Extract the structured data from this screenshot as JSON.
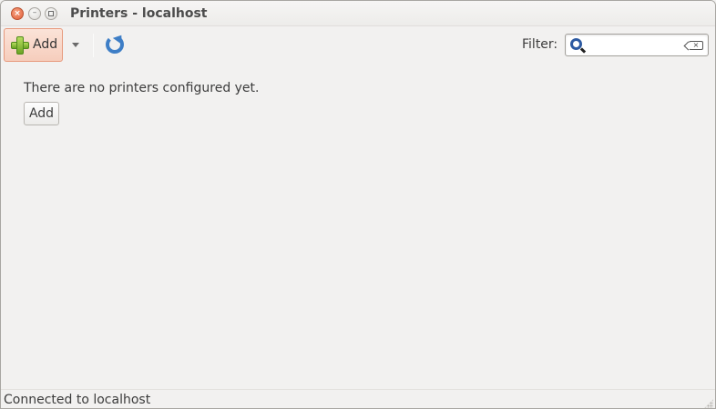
{
  "window": {
    "title": "Printers - localhost",
    "controls": [
      "close-icon",
      "minimize-icon",
      "maximize-icon"
    ]
  },
  "toolbar": {
    "add_label": "Add",
    "add_icon": "plus-icon",
    "dropdown_icon": "chevron-down-icon",
    "refresh_icon": "refresh-icon",
    "filter_label": "Filter:",
    "filter_value": "",
    "filter_icons": [
      "search-icon",
      "clear-icon"
    ]
  },
  "main": {
    "empty_message": "There are no printers configured yet.",
    "add_button_label": "Add"
  },
  "statusbar": {
    "text": "Connected to localhost"
  },
  "colors": {
    "window_bg": "#f2f1f0",
    "add_highlight": "#f6cdbc",
    "close_button": "#e2603a",
    "refresh_blue": "#3e7ec6"
  }
}
